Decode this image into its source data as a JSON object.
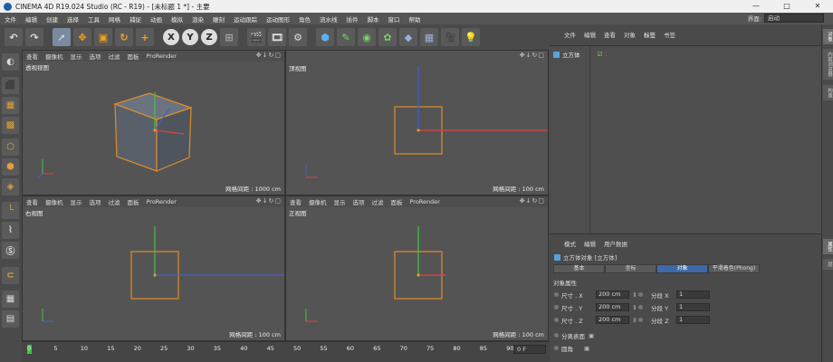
{
  "window": {
    "title": "CINEMA 4D R19.024 Studio (RC - R19) - [未标题 1 *] - 主要",
    "min": "—",
    "max": "□",
    "close": "✕"
  },
  "menu": [
    "文件",
    "编辑",
    "创建",
    "选择",
    "工具",
    "网格",
    "捕捉",
    "动画",
    "模拟",
    "渲染",
    "雕刻",
    "运动跟踪",
    "运动图形",
    "角色",
    "流水线",
    "插件",
    "脚本",
    "窗口",
    "帮助"
  ],
  "layout": {
    "label": "界面:",
    "value": "启动"
  },
  "toolbar": {
    "x": "X",
    "y": "Y",
    "z": "Z"
  },
  "viewport_menu": {
    "view": "查看",
    "camera": "摄像机",
    "display": "显示",
    "options": "选项",
    "filter": "过滤",
    "panel": "面板",
    "prorender": "ProRender"
  },
  "viewports": [
    {
      "name": "透视视图",
      "grid": "网格间距 : 1000 cm"
    },
    {
      "name": "顶视图",
      "grid": "网格间距 : 100 cm"
    },
    {
      "name": "右视图",
      "grid": "网格间距 : 100 cm"
    },
    {
      "name": "正视图",
      "grid": "网格间距 : 100 cm"
    }
  ],
  "object_manager": {
    "menu": [
      "文件",
      "编辑",
      "查看",
      "对象",
      "标签",
      "书签"
    ],
    "object": "立方体"
  },
  "attributes": {
    "menu": [
      "模式",
      "编辑",
      "用户数据"
    ],
    "header": "立方体对象 [立方体]",
    "tabs": [
      "基本",
      "坐标",
      "对象",
      "平滑着色(Phong)"
    ],
    "active_tab": "对象",
    "section": "对象属性",
    "rows": [
      {
        "label": "尺寸 . X",
        "value": "200 cm",
        "seg_label": "分段 X",
        "seg": "1"
      },
      {
        "label": "尺寸 . Y",
        "value": "200 cm",
        "seg_label": "分段 Y",
        "seg": "1"
      },
      {
        "label": "尺寸 . Z",
        "value": "200 cm",
        "seg_label": "分段 Z",
        "seg": "1"
      }
    ],
    "sep_faces": "分离表面",
    "fillet": "圆角"
  },
  "right_tabs": [
    "对象",
    "内容浏览器",
    "构造",
    "属性",
    "层"
  ],
  "timeline": {
    "ticks": [
      "0",
      "5",
      "10",
      "15",
      "20",
      "25",
      "30",
      "35",
      "40",
      "45",
      "50",
      "55",
      "60",
      "65",
      "70",
      "75",
      "80",
      "85",
      "90"
    ],
    "frame": "0 F"
  }
}
